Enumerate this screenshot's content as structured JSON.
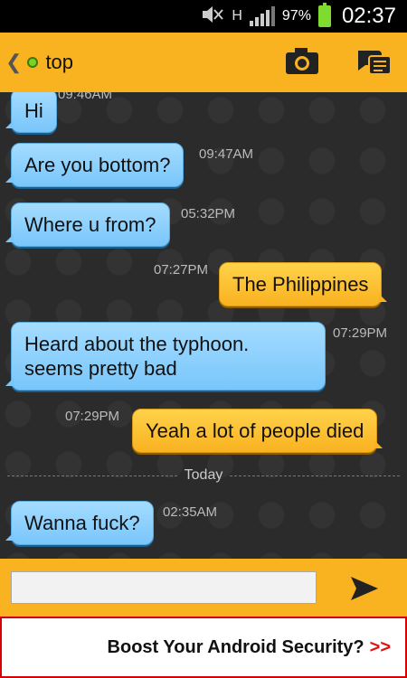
{
  "status_bar": {
    "battery_pct": "97%",
    "time": "02:37",
    "network_label": "H",
    "icons": [
      "mute-icon",
      "network-h-icon",
      "signal-icon",
      "battery-icon"
    ]
  },
  "header": {
    "back_icon": "chevron-left-icon",
    "contact_name": "top",
    "online": true,
    "camera_icon": "camera-icon",
    "chats_icon": "chats-icon"
  },
  "messages": [
    {
      "text": "Hi",
      "time": "09:46AM",
      "dir": "in"
    },
    {
      "text": "Are you bottom?",
      "time": "09:47AM",
      "dir": "in"
    },
    {
      "text": "Where u from?",
      "time": "05:32PM",
      "dir": "in"
    },
    {
      "text": "The Philippines",
      "time": "07:27PM",
      "dir": "out"
    },
    {
      "text": "Heard about the typhoon.\nseems pretty bad",
      "time": "07:29PM",
      "dir": "in"
    },
    {
      "text": "Yeah a lot of people died",
      "time": "07:29PM",
      "dir": "out"
    },
    {
      "text": "Wanna fuck?",
      "time": "02:35AM",
      "dir": "in"
    }
  ],
  "divider_label": "Today",
  "composer": {
    "value": "",
    "placeholder": "",
    "send_icon": "send-icon"
  },
  "ad": {
    "text": "Boost Your Android Security?",
    "arrow": ">>"
  },
  "colors": {
    "accent": "#f9b220",
    "bubble_in": "#79c6fb",
    "bubble_out": "#f9b220",
    "online": "#7bd321",
    "ad_border": "#d80000"
  }
}
